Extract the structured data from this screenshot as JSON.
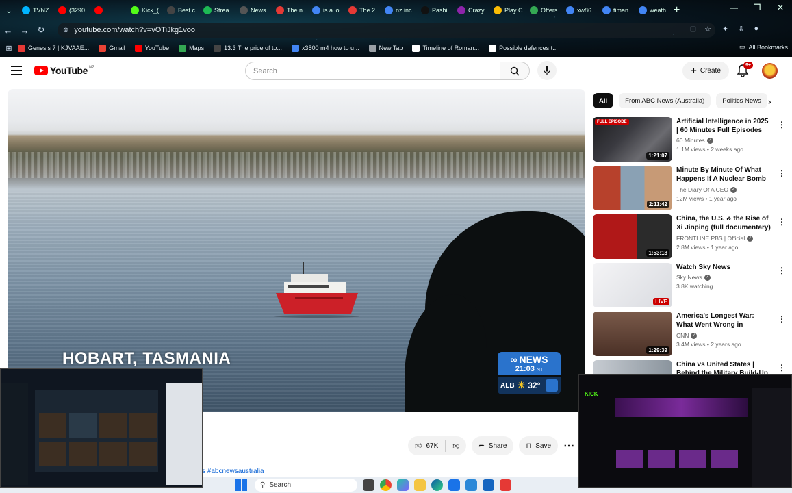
{
  "browser": {
    "tabs": [
      {
        "label": "TVNZ",
        "color": "#00b4ff"
      },
      {
        "label": "(3290",
        "color": "#ff0000"
      },
      {
        "label": "",
        "color": "#ff0000"
      },
      {
        "label": "Kick_(",
        "color": "#53fc18"
      },
      {
        "label": "Best c",
        "color": "#444444"
      },
      {
        "label": "Strea",
        "color": "#1db954"
      },
      {
        "label": "News",
        "color": "#555555"
      },
      {
        "label": "The n",
        "color": "#e53935"
      },
      {
        "label": "is a lo",
        "color": "#4285f4"
      },
      {
        "label": "The 2",
        "color": "#e53935"
      },
      {
        "label": "nz inc",
        "color": "#4285f4"
      },
      {
        "label": "Pashi",
        "color": "#111111"
      },
      {
        "label": "Crazy",
        "color": "#8e24aa"
      },
      {
        "label": "Play C",
        "color": "#fbbc04"
      },
      {
        "label": "Offers",
        "color": "#34a853"
      },
      {
        "label": "xw86",
        "color": "#4285f4"
      },
      {
        "label": "timan",
        "color": "#4285f4"
      },
      {
        "label": "weath",
        "color": "#4285f4"
      }
    ],
    "url": "youtube.com/watch?v=vOTiJkg1voo",
    "bookmarks": [
      {
        "label": "Genesis 7 | KJVAAE...",
        "color": "#e53935"
      },
      {
        "label": "Gmail",
        "color": "#ea4335"
      },
      {
        "label": "YouTube",
        "color": "#ff0000"
      },
      {
        "label": "Maps",
        "color": "#34a853"
      },
      {
        "label": "13.3 The price of to...",
        "color": "#444444"
      },
      {
        "label": "x3500 m4 how to u...",
        "color": "#4285f4"
      },
      {
        "label": "New Tab",
        "color": "#9aa0a6"
      },
      {
        "label": "Timeline of Roman...",
        "color": "#ffffff"
      },
      {
        "label": "Possible defences t...",
        "color": "#ffffff"
      }
    ],
    "all_bookmarks": "All Bookmarks"
  },
  "youtube": {
    "logo_text": "YouTube",
    "country_code": "NZ",
    "search_placeholder": "Search",
    "create_label": "Create",
    "notif_count": "9+"
  },
  "video": {
    "caption": "HOBART, TASMANIA",
    "abc_brand": "NEWS",
    "abc_time": "21:03",
    "abc_tz": "NT",
    "abc_city": "ALB",
    "abc_temp": "32°",
    "likes": "67K",
    "share_label": "Share",
    "save_label": "Save",
    "hashtag": "s #abcnewsaustralia"
  },
  "sidebar": {
    "chips": [
      "All",
      "From ABC News (Australia)",
      "Politics News"
    ],
    "recs": [
      {
        "title": "Artificial Intelligence in 2025 | 60 Minutes Full Episodes",
        "channel": "60 Minutes",
        "meta": "1.1M views • 2 weeks ago",
        "duration": "1:21:07",
        "badge": "FULL EPISODE"
      },
      {
        "title": "Minute By Minute Of What Happens If A Nuclear Bomb ...",
        "channel": "The Diary Of A CEO",
        "meta": "12M views • 1 year ago",
        "duration": "2:11:42",
        "badge": ""
      },
      {
        "title": "China, the U.S. & the Rise of Xi Jinping (full documentary) | ...",
        "channel": "FRONTLINE PBS | Official",
        "meta": "2.8M views • 1 year ago",
        "duration": "1:53:18",
        "badge": ""
      },
      {
        "title": "Watch Sky News",
        "channel": "Sky News",
        "meta": "3.8K watching",
        "duration": "LIVE",
        "badge": ""
      },
      {
        "title": "America's Longest War: What Went Wrong in Afghanistan ...",
        "channel": "CNN",
        "meta": "3.4M views • 2 years ago",
        "duration": "1:29:39",
        "badge": ""
      },
      {
        "title": "China vs United States | Behind the Military Build-Up",
        "channel": "",
        "meta": "",
        "duration": "",
        "badge": ""
      }
    ]
  },
  "taskbar": {
    "search_label": "Search"
  }
}
